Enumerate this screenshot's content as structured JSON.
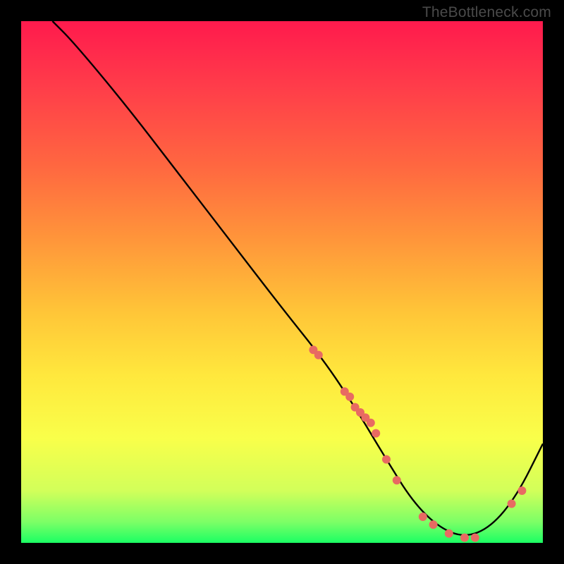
{
  "watermark": "TheBottleneck.com",
  "colors": {
    "frame": "#000000",
    "curve": "#000000",
    "dot": "#e86a62"
  },
  "chart_data": {
    "type": "line",
    "title": "",
    "xlabel": "",
    "ylabel": "",
    "xlim": [
      0,
      100
    ],
    "ylim": [
      0,
      100
    ],
    "grid": false,
    "legend": false,
    "series": [
      {
        "name": "bottleneck-curve",
        "x": [
          6,
          10,
          20,
          30,
          40,
          50,
          58,
          64,
          70,
          75,
          80,
          85,
          90,
          95,
          100
        ],
        "y": [
          100,
          96,
          84,
          71,
          58,
          45,
          35,
          26,
          16,
          8,
          3,
          1,
          3,
          9,
          19
        ]
      }
    ],
    "scatter": [
      {
        "name": "highlight-dots",
        "x": [
          56,
          57,
          62,
          63,
          64,
          65,
          66,
          67,
          68,
          70,
          72,
          77,
          79,
          82,
          85,
          87,
          94,
          96
        ],
        "y": [
          37,
          36,
          29,
          28,
          26,
          25,
          24,
          23,
          21,
          16,
          12,
          5,
          3.5,
          1.8,
          1,
          1,
          7.5,
          10
        ]
      }
    ]
  }
}
